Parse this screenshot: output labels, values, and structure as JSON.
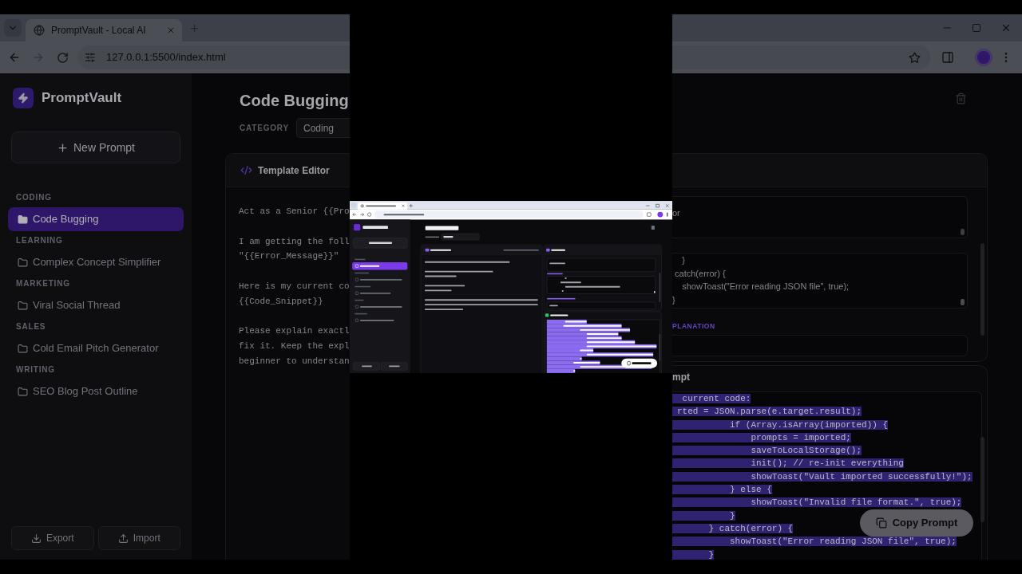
{
  "browser": {
    "tab_title": "PromptVault - Local AI",
    "url": "127.0.0.1:5500/index.html"
  },
  "sidebar": {
    "app_name": "PromptVault",
    "new_button": "New Prompt",
    "groups": [
      {
        "category": "CODING",
        "items": [
          {
            "label": "Code Bugging",
            "selected": true
          }
        ]
      },
      {
        "category": "LEARNING",
        "items": [
          {
            "label": "Complex Concept Simplifier",
            "selected": false
          }
        ]
      },
      {
        "category": "MARKETING",
        "items": [
          {
            "label": "Viral Social Thread",
            "selected": false
          }
        ]
      },
      {
        "category": "SALES",
        "items": [
          {
            "label": "Cold Email Pitch Generator",
            "selected": false
          }
        ]
      },
      {
        "category": "WRITING",
        "items": [
          {
            "label": "SEO Blog Post Outline",
            "selected": false
          }
        ]
      }
    ],
    "footer_buttons": [
      {
        "label": "Export",
        "kind": "export"
      },
      {
        "label": "Import",
        "kind": "import"
      }
    ]
  },
  "prompt": {
    "title": "Code Bugging",
    "category_label": "CATEGORY",
    "category": "Coding"
  },
  "template_editor": {
    "title": "Template Editor",
    "text": "Act as a Senior {{Pro\n\nI am getting the foll\n\"{{Error_Message}}\"\n\nHere is my current co\n{{Code_Snippet}}\n\nPlease explain exactl\nfix it. Keep the expl\nbeginner to understan"
  },
  "variables": {
    "fields": [
      {
        "kind": "textarea",
        "value": "or"
      },
      {
        "kind": "code",
        "value": "    }\n catch(error) {\n    showToast(\"Error reading JSON file\", true);\n}"
      },
      {
        "kind": "input",
        "label": "PLANATION"
      }
    ]
  },
  "final_prompt": {
    "title": "mpt",
    "selected": true,
    "text": " current code:\nrted = JSON.parse(e.target.result);\n          if (Array.isArray(imported)) {\n              prompts = imported;\n              saveToLocalStorage();\n              init(); // re-init everything\n              showToast(\"Vault imported successfully!\");\n          } else {\n              showToast(\"Invalid file format.\", true);\n          }\n      } catch(error) {\n          showToast(\"Error reading JSON file\", true);\n      }",
    "copy_button": "Copy Prompt"
  }
}
